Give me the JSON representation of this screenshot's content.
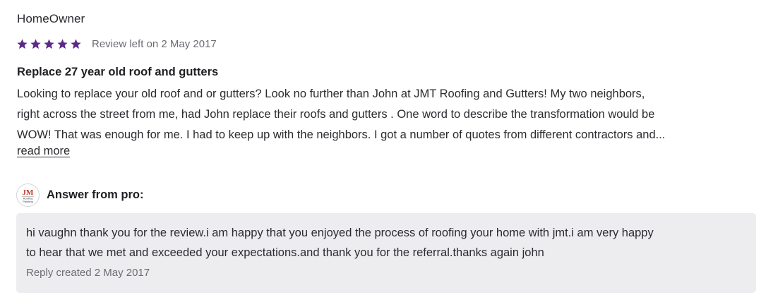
{
  "review": {
    "reviewer_name": "HomeOwner",
    "rating": 5,
    "rating_max": 5,
    "star_color": "#5b2a86",
    "date_text": "Review left on 2 May 2017",
    "title": "Replace 27 year old roof and gutters",
    "body_lines": [
      "Looking to replace your old roof and or gutters? Look no further than John at JMT Roofing and Gutters! My two neighbors,",
      "right across the street from me, had John replace their roofs and gutters . One word to describe the transformation would be",
      "WOW! That was enough for me. I had to keep up with the neighbors. I got a number of quotes from different contractors and..."
    ],
    "read_more_label": "read more"
  },
  "answer": {
    "label": "Answer from pro:",
    "avatar_logo": {
      "main": "JM",
      "sub1": "Roofing",
      "sub2": "Painting"
    },
    "reply_lines": [
      "hi vaughn thank you for the review.i am happy that you enjoyed the process of roofing your home with jmt.i am very happy",
      "to hear that we met and exceeded your expectations.and thank you for the referral.thanks again john"
    ],
    "reply_date_text": "Reply created 2 May 2017"
  }
}
